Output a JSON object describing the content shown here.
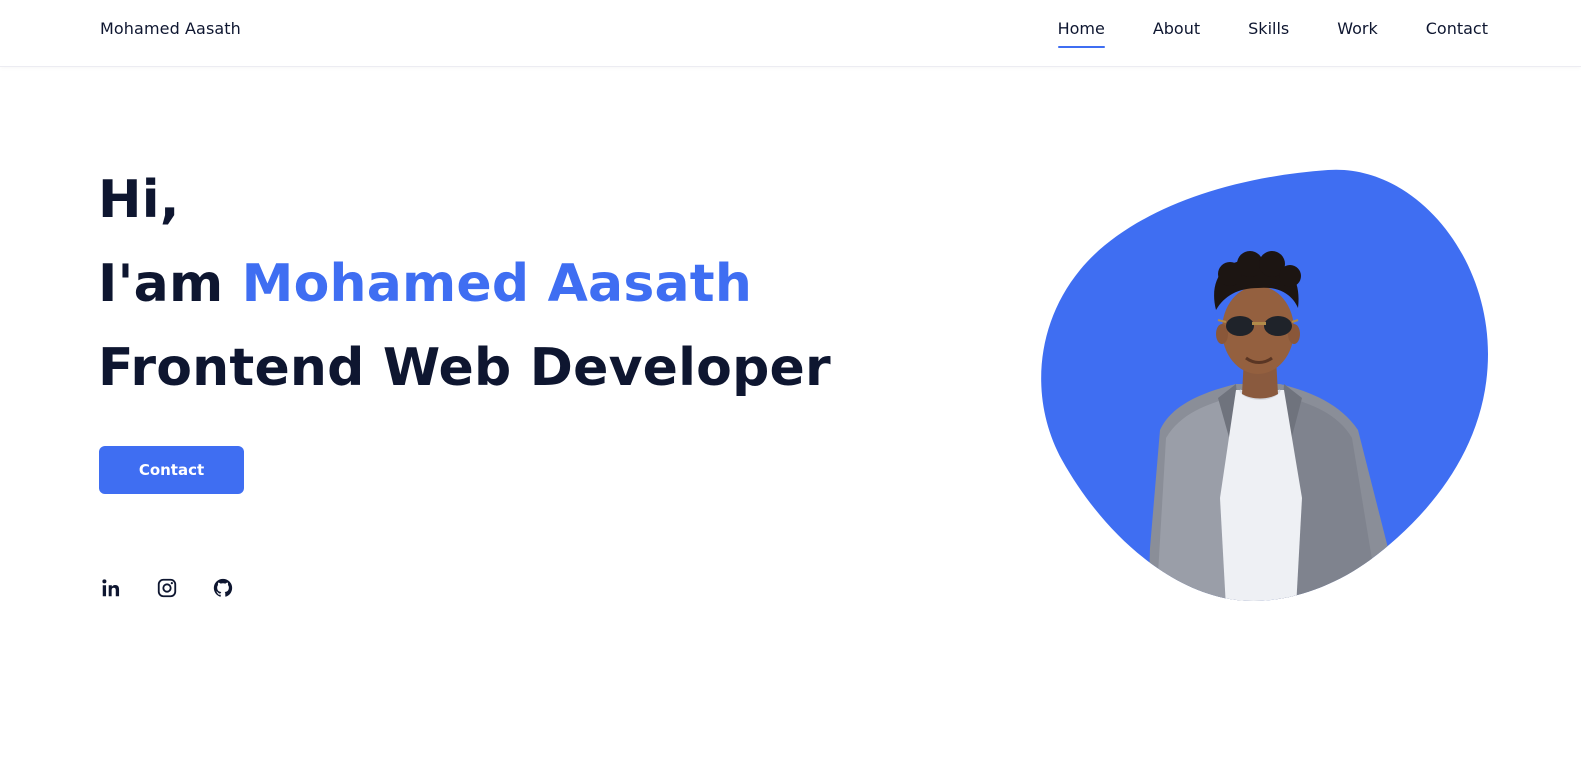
{
  "header": {
    "logo": "Mohamed Aasath",
    "nav": [
      {
        "label": "Home",
        "active": true
      },
      {
        "label": "About",
        "active": false
      },
      {
        "label": "Skills",
        "active": false
      },
      {
        "label": "Work",
        "active": false
      },
      {
        "label": "Contact",
        "active": false
      }
    ]
  },
  "hero": {
    "greeting": "Hi,",
    "intro_prefix": "I'am",
    "name": "Mohamed Aasath",
    "role": "Frontend Web Developer",
    "cta_label": "Contact"
  },
  "socials": [
    {
      "icon": "linkedin-icon"
    },
    {
      "icon": "instagram-icon"
    },
    {
      "icon": "github-icon"
    }
  ],
  "colors": {
    "accent": "#3f6ef2",
    "text": "#0e1630",
    "background": "#ffffff"
  }
}
